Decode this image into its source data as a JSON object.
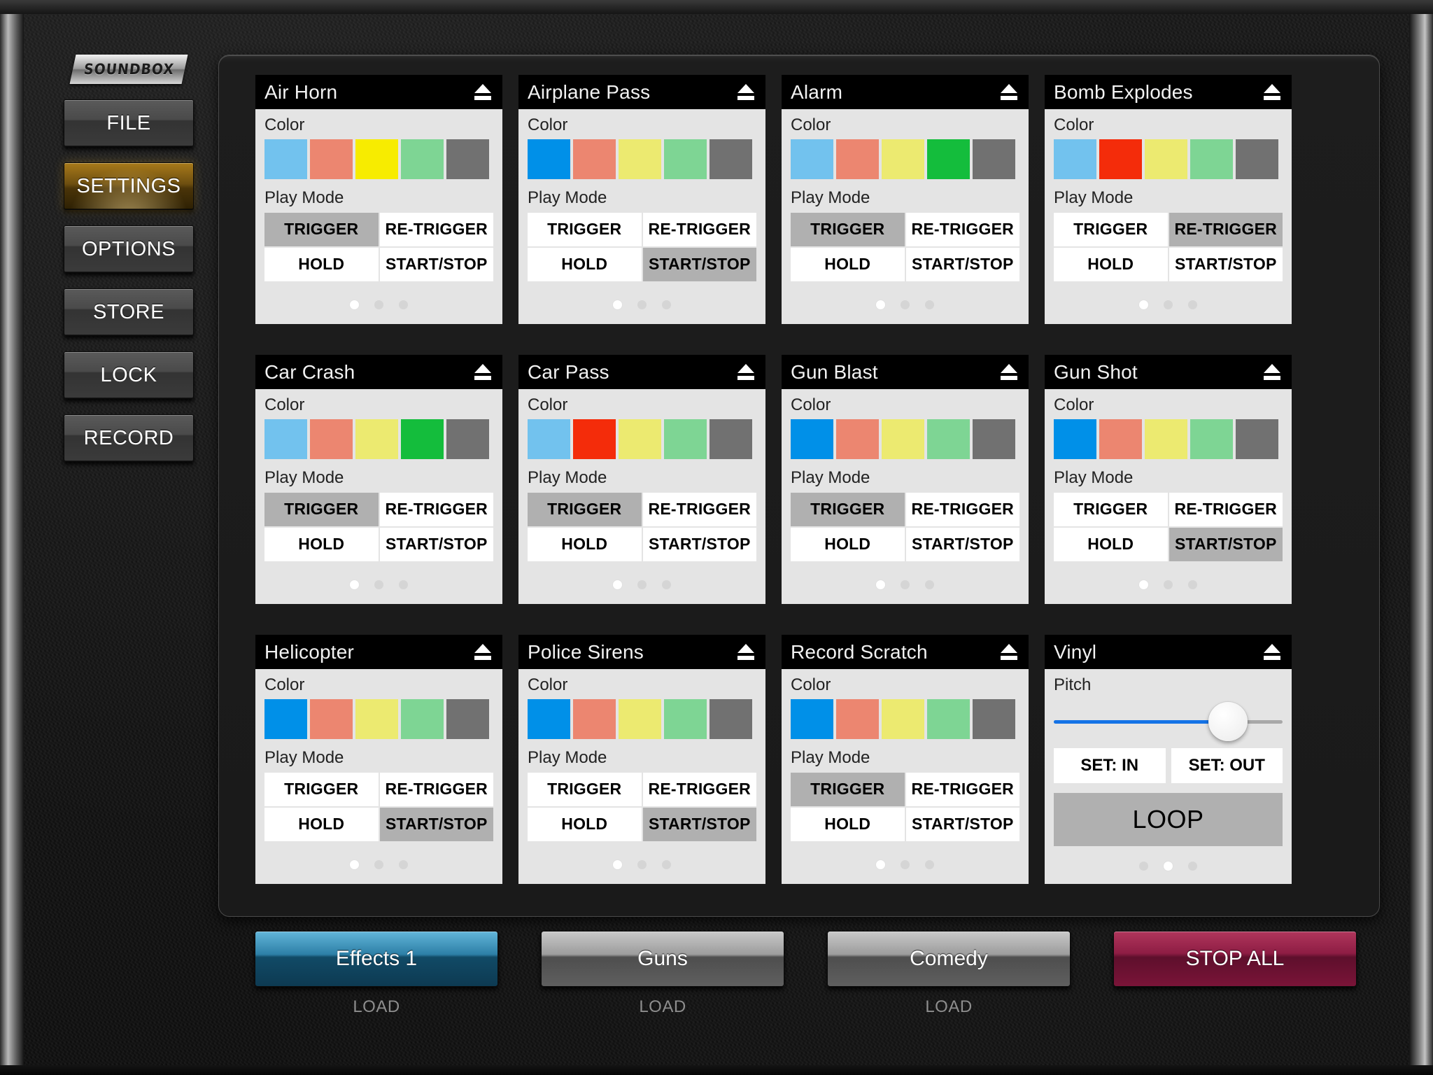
{
  "app": {
    "logo": "SOUNDBOX"
  },
  "sidebar": {
    "items": [
      {
        "label": "FILE",
        "active": false
      },
      {
        "label": "SETTINGS",
        "active": true
      },
      {
        "label": "OPTIONS",
        "active": false
      },
      {
        "label": "STORE",
        "active": false
      },
      {
        "label": "LOCK",
        "active": false
      },
      {
        "label": "RECORD",
        "active": false
      }
    ]
  },
  "labels": {
    "color": "Color",
    "play_mode": "Play Mode",
    "pitch": "Pitch",
    "eject_icon": "eject-icon"
  },
  "play_modes": [
    "TRIGGER",
    "RE-TRIGGER",
    "HOLD",
    "START/STOP"
  ],
  "palette": {
    "blue_dim": "#72c2ee",
    "blue_on": "#0090e8",
    "salmon_dim": "#ec8670",
    "red_on": "#f42c0a",
    "yellow_dim": "#ecea70",
    "yellow_on": "#f7ec00",
    "green_dim": "#7ed594",
    "green_on": "#14bd3c",
    "gray": "#717171"
  },
  "cards": [
    {
      "title": "Air Horn",
      "type": "sound",
      "swatches": [
        "#72c2ee",
        "#ec8670",
        "#f7ec00",
        "#7ed594",
        "#717171"
      ],
      "selected_color_index": 2,
      "selected_mode": "TRIGGER",
      "dots": 3,
      "active_dot": 0
    },
    {
      "title": "Airplane Pass",
      "type": "sound",
      "swatches": [
        "#0090e8",
        "#ec8670",
        "#ecea70",
        "#7ed594",
        "#717171"
      ],
      "selected_color_index": 0,
      "selected_mode": "START/STOP",
      "dots": 3,
      "active_dot": 0
    },
    {
      "title": "Alarm",
      "type": "sound",
      "swatches": [
        "#72c2ee",
        "#ec8670",
        "#ecea70",
        "#14bd3c",
        "#717171"
      ],
      "selected_color_index": 3,
      "selected_mode": "TRIGGER",
      "dots": 3,
      "active_dot": 0
    },
    {
      "title": "Bomb Explodes",
      "type": "sound",
      "swatches": [
        "#72c2ee",
        "#f42c0a",
        "#ecea70",
        "#7ed594",
        "#717171"
      ],
      "selected_color_index": 1,
      "selected_mode": "RE-TRIGGER",
      "dots": 3,
      "active_dot": 0
    },
    {
      "title": "Car Crash",
      "type": "sound",
      "swatches": [
        "#72c2ee",
        "#ec8670",
        "#ecea70",
        "#14bd3c",
        "#717171"
      ],
      "selected_color_index": 3,
      "selected_mode": "TRIGGER",
      "dots": 3,
      "active_dot": 0
    },
    {
      "title": "Car Pass",
      "type": "sound",
      "swatches": [
        "#72c2ee",
        "#f42c0a",
        "#ecea70",
        "#7ed594",
        "#717171"
      ],
      "selected_color_index": 1,
      "selected_mode": "TRIGGER",
      "dots": 3,
      "active_dot": 0
    },
    {
      "title": "Gun Blast",
      "type": "sound",
      "swatches": [
        "#0090e8",
        "#ec8670",
        "#ecea70",
        "#7ed594",
        "#717171"
      ],
      "selected_color_index": 0,
      "selected_mode": "TRIGGER",
      "dots": 3,
      "active_dot": 0
    },
    {
      "title": "Gun Shot",
      "type": "sound",
      "swatches": [
        "#0090e8",
        "#ec8670",
        "#ecea70",
        "#7ed594",
        "#717171"
      ],
      "selected_color_index": 0,
      "selected_mode": "START/STOP",
      "dots": 3,
      "active_dot": 0
    },
    {
      "title": "Helicopter",
      "type": "sound",
      "swatches": [
        "#0090e8",
        "#ec8670",
        "#ecea70",
        "#7ed594",
        "#717171"
      ],
      "selected_color_index": 0,
      "selected_mode": "START/STOP",
      "dots": 3,
      "active_dot": 0
    },
    {
      "title": "Police Sirens",
      "type": "sound",
      "swatches": [
        "#0090e8",
        "#ec8670",
        "#ecea70",
        "#7ed594",
        "#717171"
      ],
      "selected_color_index": 0,
      "selected_mode": "START/STOP",
      "dots": 3,
      "active_dot": 0
    },
    {
      "title": "Record Scratch",
      "type": "sound",
      "swatches": [
        "#0090e8",
        "#ec8670",
        "#ecea70",
        "#7ed594",
        "#717171"
      ],
      "selected_color_index": 0,
      "selected_mode": "TRIGGER",
      "dots": 3,
      "active_dot": 0
    },
    {
      "title": "Vinyl",
      "type": "vinyl",
      "pitch_percent": 76,
      "set_in_label": "SET: IN",
      "set_out_label": "SET: OUT",
      "loop_label": "LOOP",
      "dots": 3,
      "active_dot": 1
    }
  ],
  "banks": [
    {
      "label": "Effects 1",
      "style": "blue",
      "load_label": "LOAD",
      "has_load": true
    },
    {
      "label": "Guns",
      "style": "gray",
      "load_label": "LOAD",
      "has_load": true
    },
    {
      "label": "Comedy",
      "style": "gray",
      "load_label": "LOAD",
      "has_load": true
    },
    {
      "label": "STOP ALL",
      "style": "red",
      "load_label": "",
      "has_load": false
    }
  ]
}
